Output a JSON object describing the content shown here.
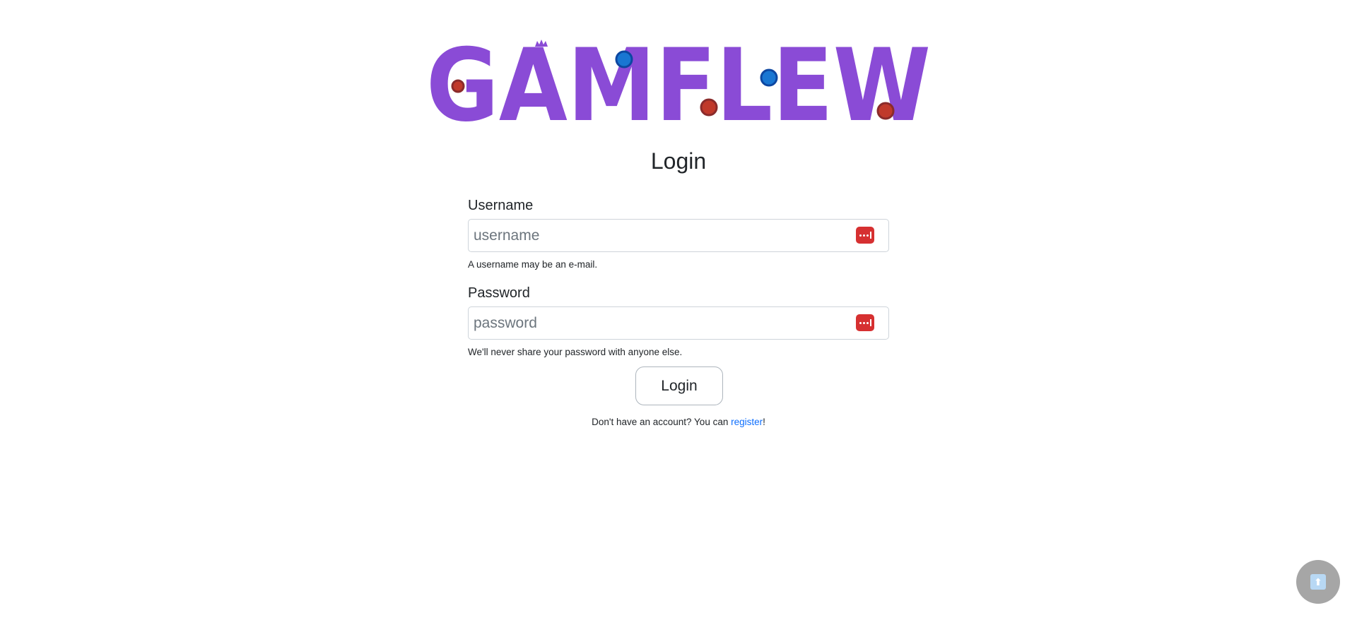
{
  "logo": {
    "text": "GAMFLEW",
    "letter_color": "#8a4bd6",
    "dot_blue": "#1976d2",
    "dot_red": "#c0392b"
  },
  "page_title": "Login",
  "username": {
    "label": "Username",
    "placeholder": "username",
    "help": "A username may be an e-mail.",
    "icon": "password-manager-icon"
  },
  "password": {
    "label": "Password",
    "placeholder": "password",
    "help": "We'll never share your password with anyone else.",
    "icon": "password-manager-icon"
  },
  "login_button": "Login",
  "footer": {
    "prefix": "Don't have an account? You can ",
    "link": "register",
    "suffix": "!"
  },
  "scroll_top": {
    "icon": "arrow-up-icon",
    "glyph": "⬆"
  },
  "colors": {
    "accent": "#8a4bd6",
    "link": "#0d6efd",
    "icon_red": "#d63031"
  }
}
